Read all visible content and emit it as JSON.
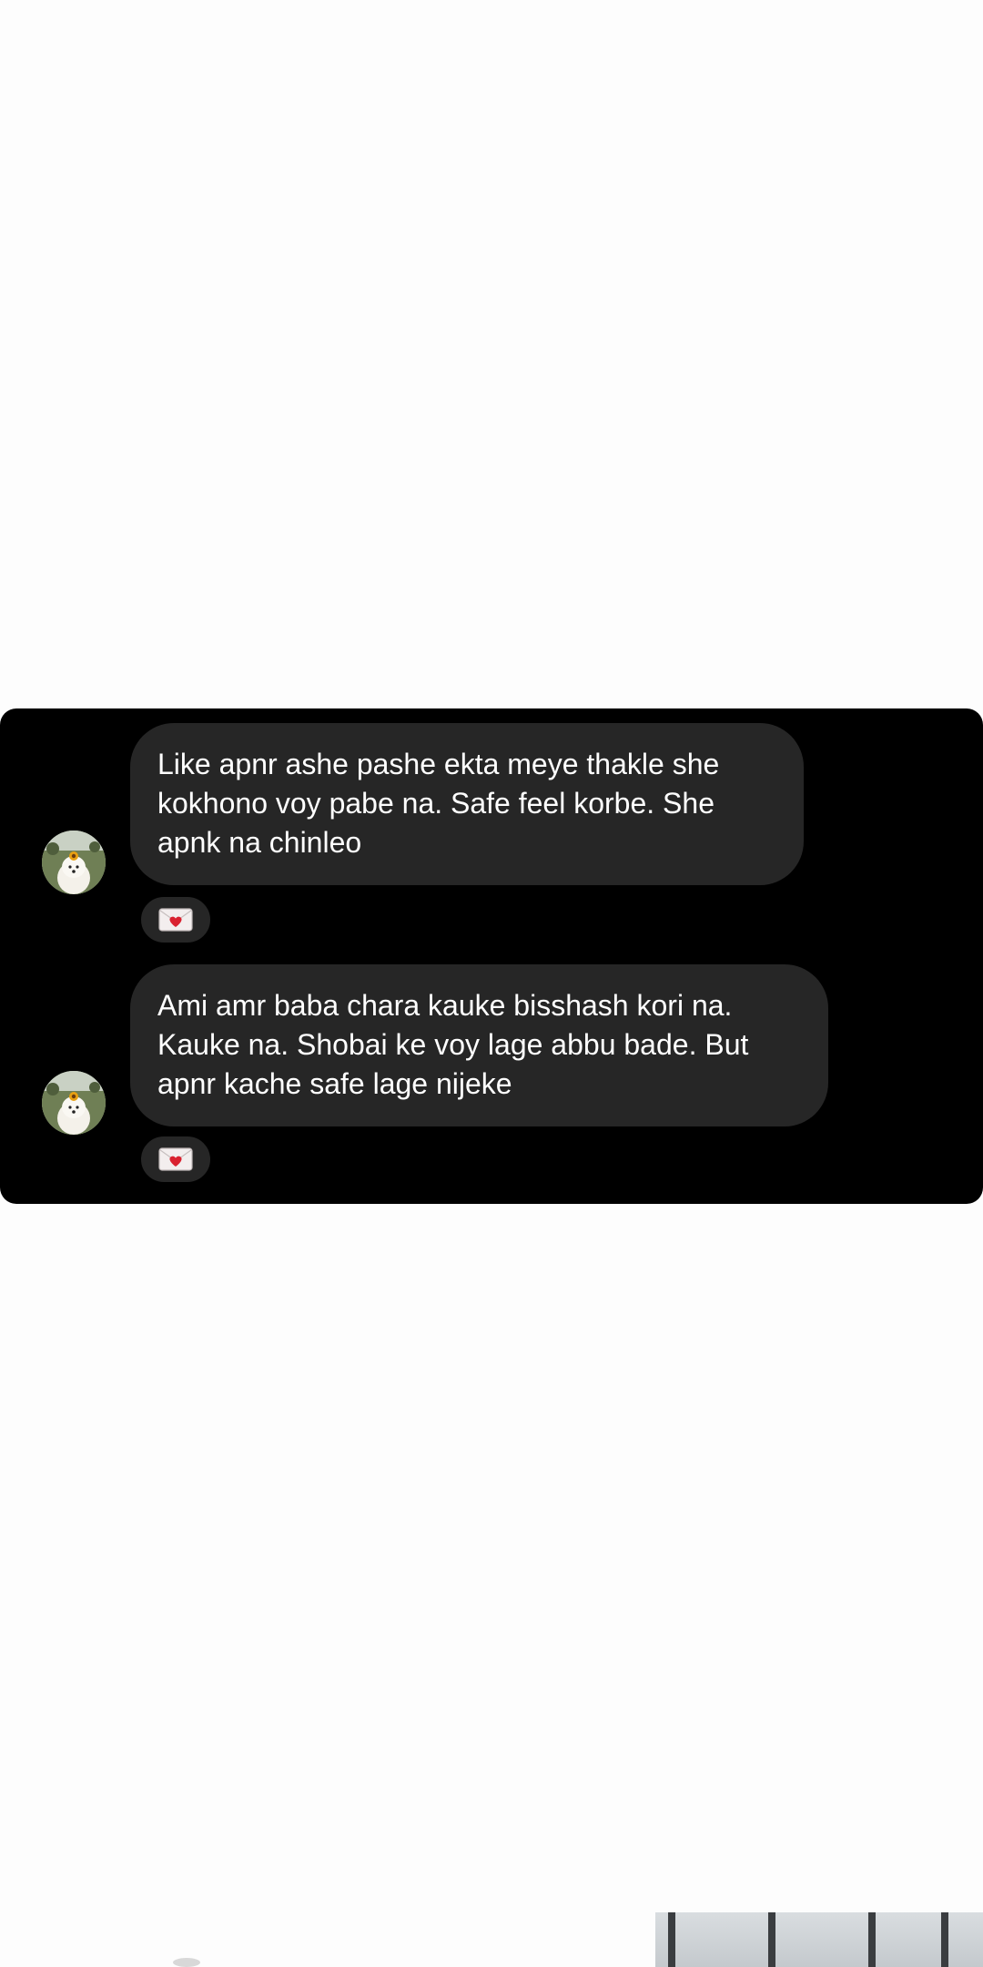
{
  "messages": [
    {
      "text": "Like apnr ashe pashe ekta meye thakle she kokhono voy pabe na. Safe feel korbe. She apnk na chinleo",
      "reaction": "love-letter-icon"
    },
    {
      "text": "Ami amr baba chara kauke bisshash kori na. Kauke na. Shobai ke voy lage abbu bade. But apnr kache safe lage nijeke",
      "reaction": "love-letter-icon"
    }
  ],
  "colors": {
    "card_background": "#000000",
    "bubble_background": "#262626",
    "bubble_text": "#ffffff",
    "page_background": "#fdfdfd",
    "heart": "#d9212f"
  }
}
